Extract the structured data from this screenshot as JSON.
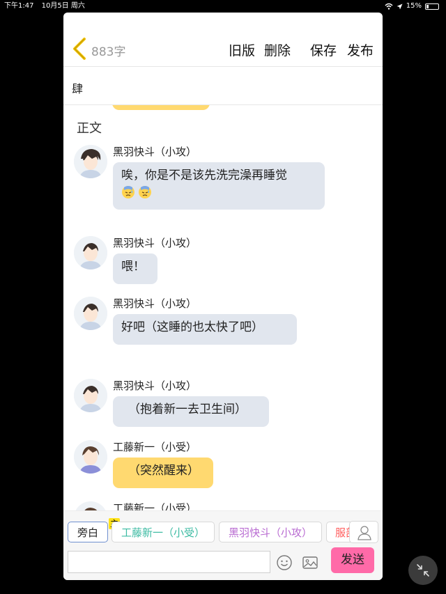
{
  "status_bar": {
    "time": "下午1:47",
    "date": "10月5日 周六",
    "battery": "15%"
  },
  "editor": {
    "word_count": "883字",
    "buttons": {
      "old_version": "旧版",
      "delete": "删除",
      "save": "保存",
      "publish": "发布"
    },
    "chapter_title": "肆",
    "section_label": "正文"
  },
  "messages": [
    {
      "name": "黑羽快斗（小攻）",
      "text": "唉，你是不是该先洗完澡再睡觉",
      "emojis": [
        "sweat-emoji",
        "sweat-emoji"
      ],
      "bubble_color": "#e1e6ee"
    },
    {
      "name": "黑羽快斗（小攻）",
      "text": "喂！",
      "bubble_color": "#e1e6ee"
    },
    {
      "name": "黑羽快斗（小攻）",
      "text": "好吧（这睡的也太快了吧）",
      "bubble_color": "#e1e6ee"
    },
    {
      "name": "黑羽快斗（小攻）",
      "text": "（抱着新一去卫生间）",
      "bubble_color": "#e1e6ee"
    },
    {
      "name": "工藤新一（小受）",
      "text": "（突然醒来）",
      "bubble_color": "#ffd970"
    },
    {
      "name": "工藤新一（小受）",
      "text": "",
      "bubble_color": "#ffd970"
    }
  ],
  "roles": {
    "narrator": "旁白",
    "main_tag": "主",
    "kudo": "工藤新一（小受）",
    "kaito": "黑羽快斗（小攻）",
    "extra": "服部"
  },
  "composer": {
    "send": "发送",
    "input_value": ""
  },
  "colors": {
    "accent_yellow": "#ffd970",
    "send_pink": "#ff6aa8",
    "bubble_gray": "#e1e6ee",
    "kudo_green": "#3dbba3",
    "kaito_purple": "#b86ad1"
  },
  "icons": [
    "wifi-icon",
    "location-icon",
    "battery-icon",
    "back-chevron-icon",
    "person-icon",
    "smile-icon",
    "image-icon",
    "collapse-icon"
  ]
}
